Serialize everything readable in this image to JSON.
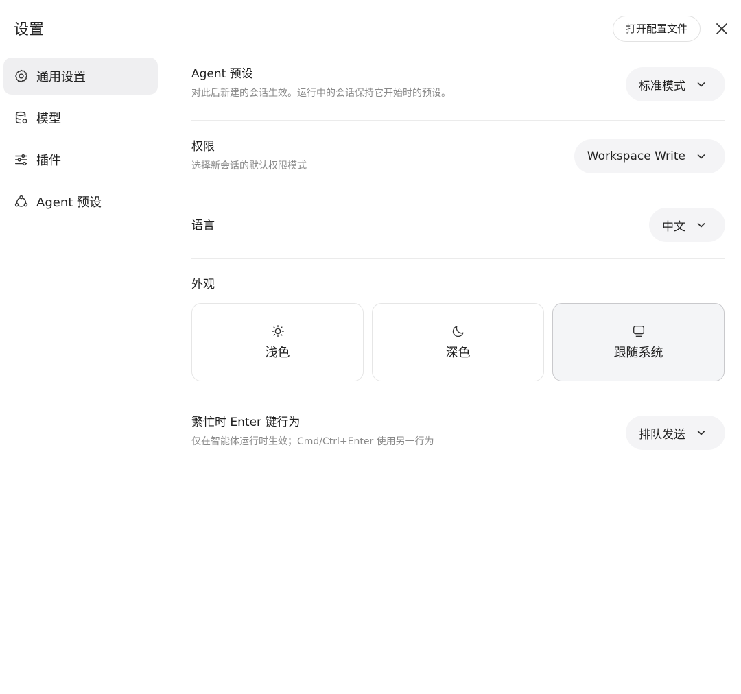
{
  "window": {
    "title": "设置",
    "open_config_label": "打开配置文件"
  },
  "sidebar": {
    "items": [
      {
        "label": "通用设置",
        "icon": "gear-icon",
        "active": true
      },
      {
        "label": "模型",
        "icon": "database-icon",
        "active": false
      },
      {
        "label": "插件",
        "icon": "sliders-icon",
        "active": false
      },
      {
        "label": "Agent 预设",
        "icon": "agent-icon",
        "active": false
      }
    ]
  },
  "settings": {
    "agent_preset": {
      "title": "Agent 预设",
      "description": "对此后新建的会话生效。运行中的会话保持它开始时的预设。",
      "value": "标准模式"
    },
    "permission": {
      "title": "权限",
      "description": "选择新会话的默认权限模式",
      "value": "Workspace Write"
    },
    "language": {
      "title": "语言",
      "value": "中文"
    },
    "appearance": {
      "title": "外观",
      "options": [
        {
          "label": "浅色",
          "icon": "sun-icon",
          "selected": false
        },
        {
          "label": "深色",
          "icon": "moon-icon",
          "selected": false
        },
        {
          "label": "跟随系统",
          "icon": "monitor-icon",
          "selected": true
        }
      ]
    },
    "busy_enter": {
      "title": "繁忙时 Enter 键行为",
      "description": "仅在智能体运行时生效；Cmd/Ctrl+Enter 使用另一行为",
      "value": "排队发送"
    }
  }
}
